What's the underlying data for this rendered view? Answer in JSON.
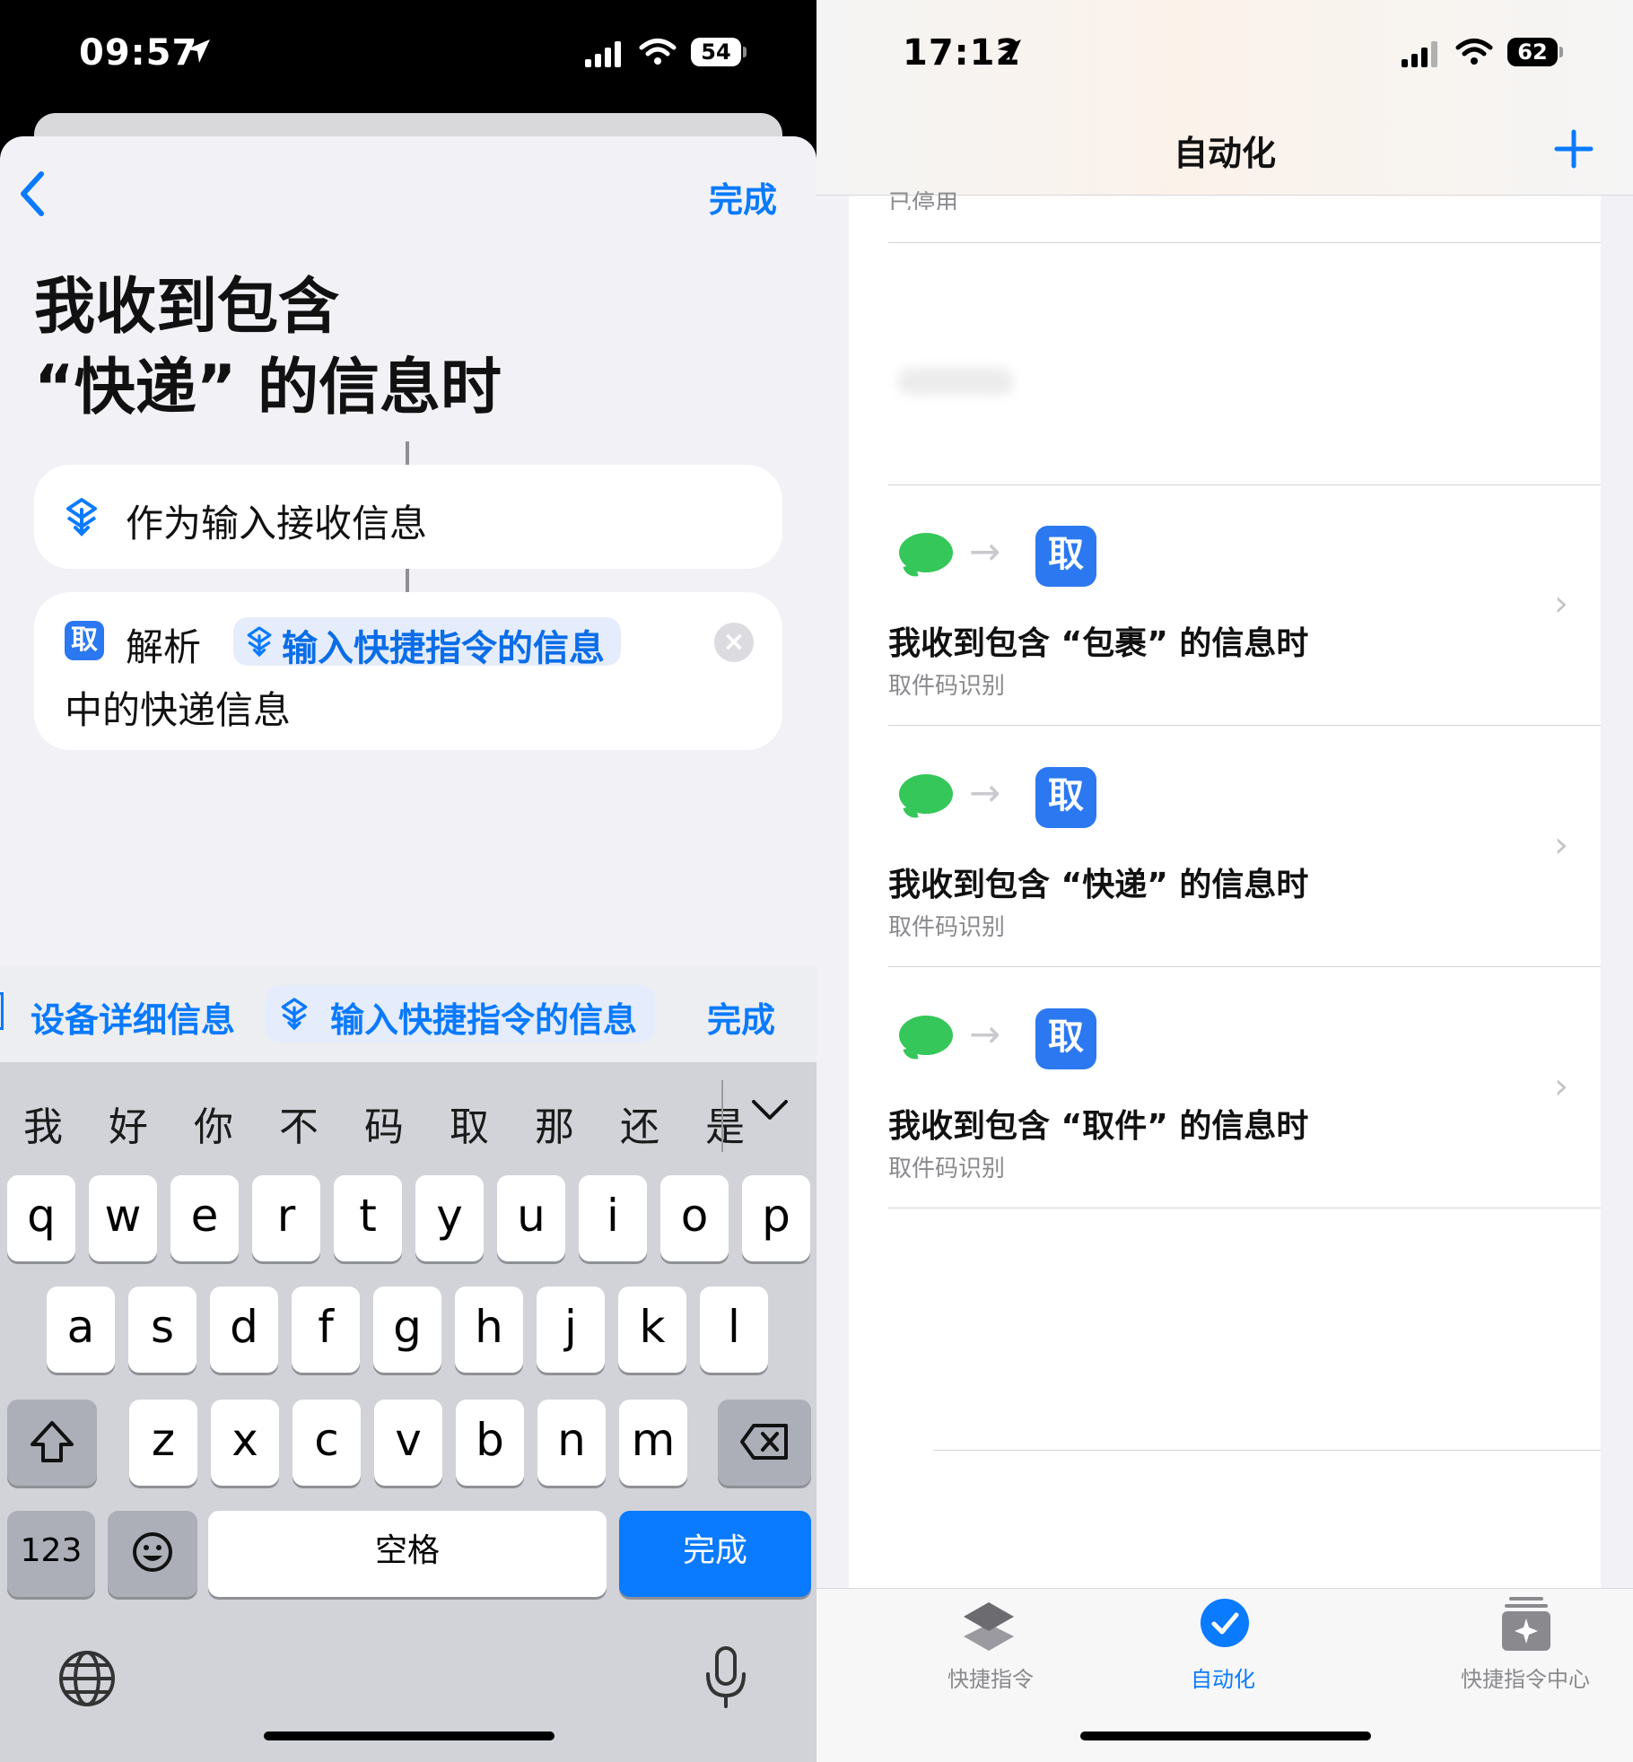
{
  "left": {
    "status": {
      "time": "09:57",
      "battery": "54"
    },
    "nav": {
      "done": "完成"
    },
    "title_line1": "我收到包含",
    "title_line2": "“快递” 的信息时",
    "actions": [
      {
        "label": "作为输入接收信息"
      },
      {
        "verb": "解析",
        "variable": "输入快捷指令的信息",
        "suffix": "中的快递信息"
      }
    ],
    "suggestions": {
      "item1": "设备详细信息",
      "item2": "输入快捷指令的信息",
      "done": "完成"
    },
    "candidates": [
      "我",
      "好",
      "你",
      "不",
      "码",
      "取",
      "那",
      "还",
      "是"
    ],
    "keyboard": {
      "row1": [
        "q",
        "w",
        "e",
        "r",
        "t",
        "y",
        "u",
        "i",
        "o",
        "p"
      ],
      "row2": [
        "a",
        "s",
        "d",
        "f",
        "g",
        "h",
        "j",
        "k",
        "l"
      ],
      "row3": [
        "z",
        "x",
        "c",
        "v",
        "b",
        "n",
        "m"
      ],
      "numbers": "123",
      "space": "空格",
      "return": "完成"
    }
  },
  "right": {
    "status": {
      "time": "17:12",
      "battery": "62"
    },
    "header": {
      "title": "自动化"
    },
    "disabled_label": "已停用",
    "automations": [
      {
        "title": "我收到包含 “包裹” 的信息时",
        "subtitle": "取件码识别",
        "icon_text": "取"
      },
      {
        "title": "我收到包含 “快递” 的信息时",
        "subtitle": "取件码识别",
        "icon_text": "取"
      },
      {
        "title": "我收到包含 “取件” 的信息时",
        "subtitle": "取件码识别",
        "icon_text": "取"
      }
    ],
    "tabs": [
      {
        "label": "快捷指令"
      },
      {
        "label": "自动化"
      },
      {
        "label": "快捷指令中心"
      }
    ],
    "colors": {
      "accent": "#0a7aff",
      "message_green": "#35c759"
    }
  }
}
